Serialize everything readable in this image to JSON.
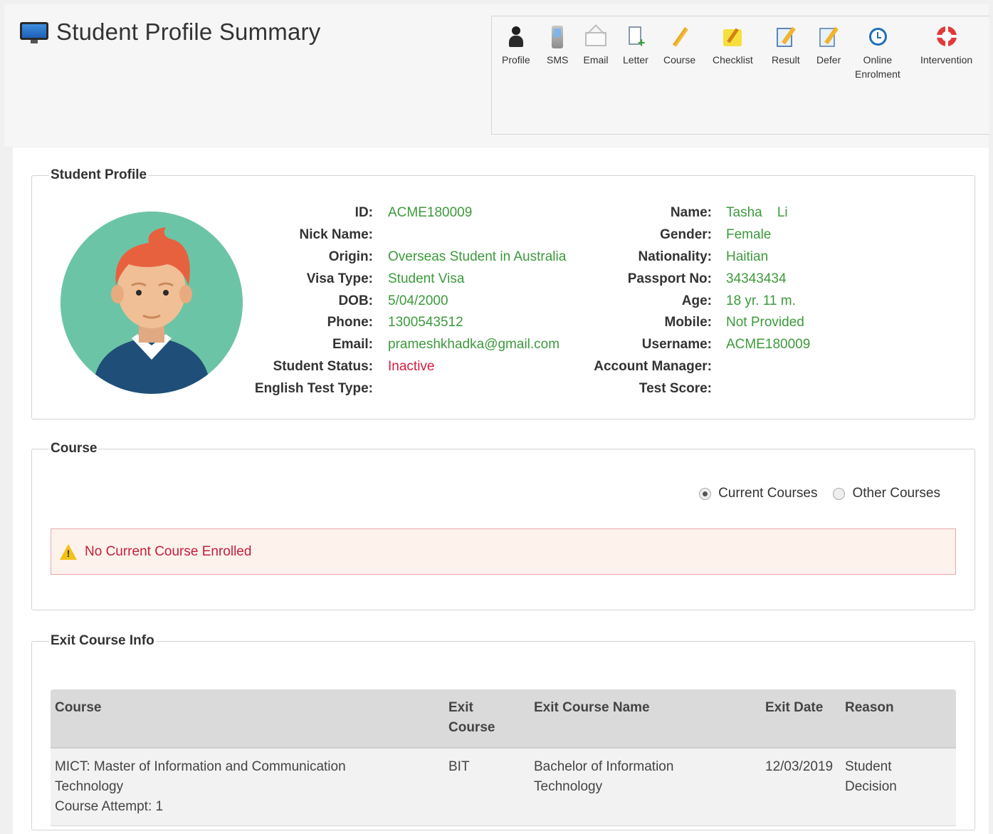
{
  "page": {
    "title": "Student Profile Summary"
  },
  "toolbar": {
    "items": [
      {
        "label": "Profile",
        "icon": "profile-icon"
      },
      {
        "label": "SMS",
        "icon": "sms-icon"
      },
      {
        "label": "Email",
        "icon": "email-icon"
      },
      {
        "label": "Letter",
        "icon": "letter-icon"
      },
      {
        "label": "Course",
        "icon": "course-icon"
      },
      {
        "label": "Checklist",
        "icon": "checklist-icon"
      },
      {
        "label": "Result",
        "icon": "result-icon"
      },
      {
        "label": "Defer",
        "icon": "defer-icon"
      },
      {
        "label_line1": "Online",
        "label_line2": "Enrolment",
        "icon": "clock-icon"
      },
      {
        "label": "Intervention",
        "icon": "lifebuoy-icon"
      }
    ]
  },
  "profile": {
    "legend": "Student Profile",
    "left": [
      {
        "label": "ID:",
        "value": "ACME180009"
      },
      {
        "label": "Nick Name:",
        "value": ""
      },
      {
        "label": "Origin:",
        "value": "Overseas Student in Australia"
      },
      {
        "label": "Visa Type:",
        "value": "Student Visa"
      },
      {
        "label": "DOB:",
        "value": "5/04/2000"
      },
      {
        "label": "Phone:",
        "value": "1300543512"
      },
      {
        "label": "Email:",
        "value": "prameshkhadka@gmail.com"
      },
      {
        "label": "Student Status:",
        "value": "Inactive"
      },
      {
        "label": "English Test Type:",
        "value": ""
      }
    ],
    "right": [
      {
        "label": "Name:",
        "value": "Tasha    Li"
      },
      {
        "label": "Gender:",
        "value": "Female"
      },
      {
        "label": "Nationality:",
        "value": "Haitian"
      },
      {
        "label": "Passport No:",
        "value": "34343434"
      },
      {
        "label": "Age:",
        "value": "18 yr. 11 m."
      },
      {
        "label": "Mobile:",
        "value": "Not Provided"
      },
      {
        "label": "Username:",
        "value": "ACME180009"
      },
      {
        "label": "Account Manager:",
        "value": ""
      },
      {
        "label": "Test Score:",
        "value": ""
      }
    ],
    "status_color": "#d81b40",
    "value_color": "#3c9a3c"
  },
  "course": {
    "legend": "Course",
    "radio_current": "Current Courses",
    "radio_other": "Other Courses",
    "selected": "Current Courses",
    "alert": "No Current Course Enrolled"
  },
  "exit": {
    "legend": "Exit Course Info",
    "headers": {
      "course": "Course",
      "exit_course_l1": "Exit",
      "exit_course_l2": "Course",
      "exit_course_name": "Exit Course Name",
      "exit_date": "Exit Date",
      "reason": "Reason"
    },
    "row": {
      "course_l1": "MICT: Master of Information and Communication",
      "course_l2": "Technology",
      "course_attempt": "Course Attempt: 1",
      "exit_course": "BIT",
      "exit_course_name_l1": "Bachelor of Information",
      "exit_course_name_l2": "Technology",
      "exit_date": "12/03/2019",
      "reason_l1": "Student",
      "reason_l2": "Decision"
    }
  }
}
